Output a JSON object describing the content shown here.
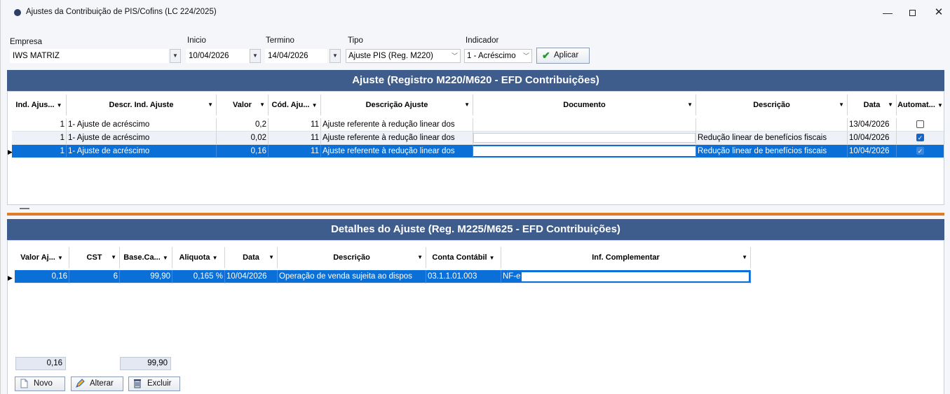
{
  "window": {
    "title": "Ajustes da Contribuição de PIS/Cofins (LC 224/2025)",
    "minimize": "—",
    "close": "✕"
  },
  "filters": {
    "empresa_label": "Empresa",
    "empresa_value": "IWS MATRIZ",
    "inicio_label": "Inicio",
    "inicio_value": "10/04/2026",
    "termino_label": "Termino",
    "termino_value": "14/04/2026",
    "tipo_label": "Tipo",
    "tipo_value": "Ajuste PIS (Reg. M220)",
    "indicador_label": "Indicador",
    "indicador_value": "1 - Acréscimo",
    "apply_label": "Aplicar"
  },
  "ajuste": {
    "header": "Ajuste (Registro M220/M620 - EFD Contribuições)",
    "columns": [
      "Ind. Ajus...",
      "Descr. Ind. Ajuste",
      "Valor",
      "Cód. Aju...",
      "Descrição Ajuste",
      "Documento",
      "Descrição",
      "Data",
      "Automat..."
    ],
    "rows": [
      {
        "ind": "1",
        "descr_ind": "1- Ajuste de acréscimo",
        "valor": "0,2",
        "cod": "11",
        "descr_ajuste": "Ajuste referente à redução linear dos",
        "documento": "",
        "descricao": "",
        "data": "13/04/2026",
        "automatico": false
      },
      {
        "ind": "1",
        "descr_ind": "1- Ajuste de acréscimo",
        "valor": "0,02",
        "cod": "11",
        "descr_ajuste": "Ajuste referente à redução linear dos",
        "documento": "",
        "descricao": "Redução linear de benefícios fiscais",
        "data": "10/04/2026",
        "automatico": true
      },
      {
        "ind": "1",
        "descr_ind": "1- Ajuste de acréscimo",
        "valor": "0,16",
        "cod": "11",
        "descr_ajuste": "Ajuste referente à redução linear dos",
        "documento": "",
        "descricao": "Redução linear de benefícios fiscais",
        "data": "10/04/2026",
        "automatico": true
      }
    ]
  },
  "detalhes": {
    "header": "Detalhes do Ajuste (Reg. M225/M625 - EFD Contribuições)",
    "columns": [
      "Valor Aj...",
      "CST",
      "Base.Ca...",
      "Aliquota",
      "Data",
      "Descrição",
      "Conta Contábil",
      "Inf. Complementar"
    ],
    "rows": [
      {
        "valor": "0,16",
        "cst": "6",
        "base": "99,90",
        "aliquota": "0,165 %",
        "data": "10/04/2026",
        "descricao": "Operação de venda sujeita ao dispos",
        "conta": "03.1.1.01.003",
        "inf": "NF-e"
      }
    ]
  },
  "totals": {
    "valor": "0,16",
    "base": "99,90"
  },
  "buttons": {
    "novo": "Novo",
    "alterar": "Alterar",
    "excluir": "Excluir"
  }
}
